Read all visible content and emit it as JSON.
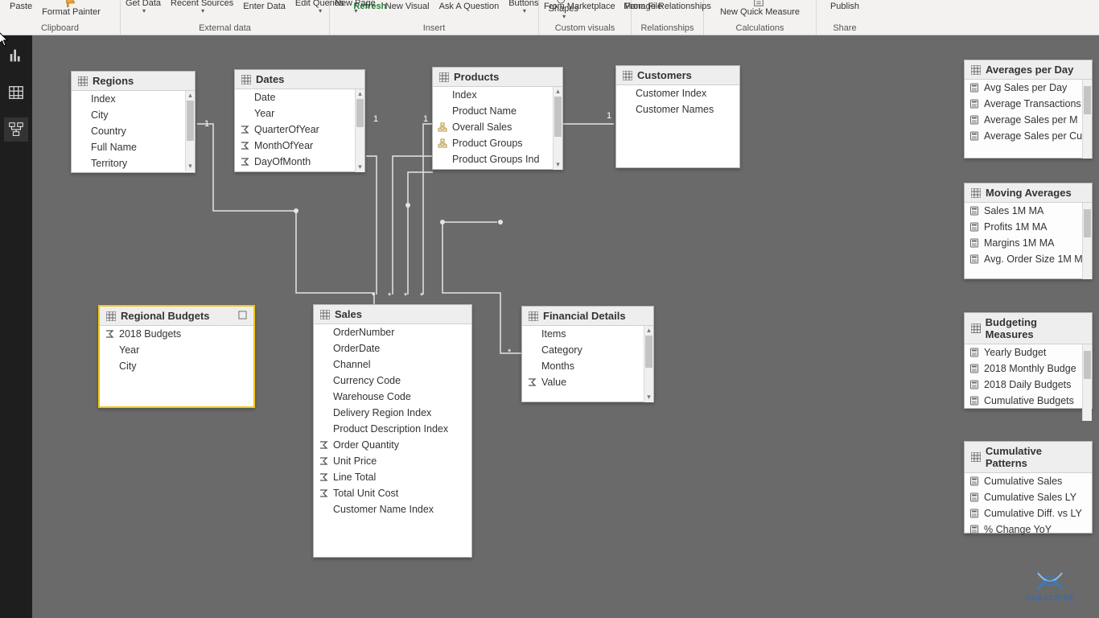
{
  "ribbon": {
    "paste": "Paste",
    "format_painter": "Format Painter",
    "get_data": "Get Data",
    "recent_sources": "Recent Sources",
    "enter_data": "Enter Data",
    "edit_queries": "Edit Queries",
    "refresh": "Refresh",
    "new_page": "New Page",
    "new_visual": "New Visual",
    "ask_a_question": "Ask A Question",
    "buttons": "Buttons",
    "shapes": "Shapes",
    "from_marketplace": "From Marketplace",
    "from_file": "From File",
    "manage_relationships": "Manage Relationships",
    "new_quick_measure": "New Quick Measure",
    "publish": "Publish",
    "groups": {
      "clipboard": "Clipboard",
      "external_data": "External data",
      "insert": "Insert",
      "custom_visuals": "Custom visuals",
      "relationships": "Relationships",
      "calculations": "Calculations",
      "share": "Share"
    }
  },
  "tables": {
    "regions": {
      "title": "Regions",
      "fields": [
        "Index",
        "City",
        "Country",
        "Full Name",
        "Territory"
      ]
    },
    "dates": {
      "title": "Dates",
      "fields": [
        {
          "n": "Date"
        },
        {
          "n": "Year"
        },
        {
          "n": "QuarterOfYear",
          "sigma": true
        },
        {
          "n": "MonthOfYear",
          "sigma": true
        },
        {
          "n": "DayOfMonth",
          "sigma": true
        }
      ]
    },
    "products": {
      "title": "Products",
      "fields": [
        {
          "n": "Index"
        },
        {
          "n": "Product Name"
        },
        {
          "n": "Overall Sales",
          "hier": true
        },
        {
          "n": "Product Groups",
          "hier": true
        },
        {
          "n": "Product Groups Ind"
        }
      ]
    },
    "customers": {
      "title": "Customers",
      "fields": [
        "Customer Index",
        "Customer Names"
      ]
    },
    "regional_budgets": {
      "title": "Regional Budgets",
      "fields": [
        {
          "n": "2018 Budgets",
          "sigma": true
        },
        {
          "n": "Year"
        },
        {
          "n": "City"
        }
      ]
    },
    "sales": {
      "title": "Sales",
      "fields": [
        {
          "n": "OrderNumber"
        },
        {
          "n": "OrderDate"
        },
        {
          "n": "Channel"
        },
        {
          "n": "Currency Code"
        },
        {
          "n": "Warehouse Code"
        },
        {
          "n": "Delivery Region Index"
        },
        {
          "n": "Product Description Index"
        },
        {
          "n": "Order Quantity",
          "sigma": true
        },
        {
          "n": "Unit Price",
          "sigma": true
        },
        {
          "n": "Line Total",
          "sigma": true
        },
        {
          "n": "Total Unit Cost",
          "sigma": true
        },
        {
          "n": "Customer Name Index"
        }
      ]
    },
    "financial": {
      "title": "Financial Details",
      "fields": [
        {
          "n": "Items"
        },
        {
          "n": "Category"
        },
        {
          "n": "Months"
        },
        {
          "n": "Value",
          "sigma": true
        }
      ]
    }
  },
  "measure_tables": {
    "averages": {
      "title": "Averages per Day",
      "items": [
        "Avg Sales per Day",
        "Average Transactions",
        "Average Sales per M",
        "Average Sales per Cu"
      ]
    },
    "moving": {
      "title": "Moving Averages",
      "items": [
        "Sales 1M MA",
        "Profits 1M MA",
        "Margins 1M MA",
        "Avg. Order Size 1M M"
      ]
    },
    "budgeting": {
      "title": "Budgeting Measures",
      "items": [
        "Yearly Budget",
        "2018 Monthly Budge",
        "2018 Daily Budgets",
        "Cumulative Budgets"
      ]
    },
    "cumulative": {
      "title": "Cumulative Patterns",
      "items": [
        "Cumulative Sales",
        "Cumulative Sales LY",
        "Cumulative Diff. vs LY",
        "% Change YoY"
      ]
    }
  },
  "cardinality": {
    "one": "1",
    "many": "*"
  },
  "subscribe": "SUBSCRIBE"
}
